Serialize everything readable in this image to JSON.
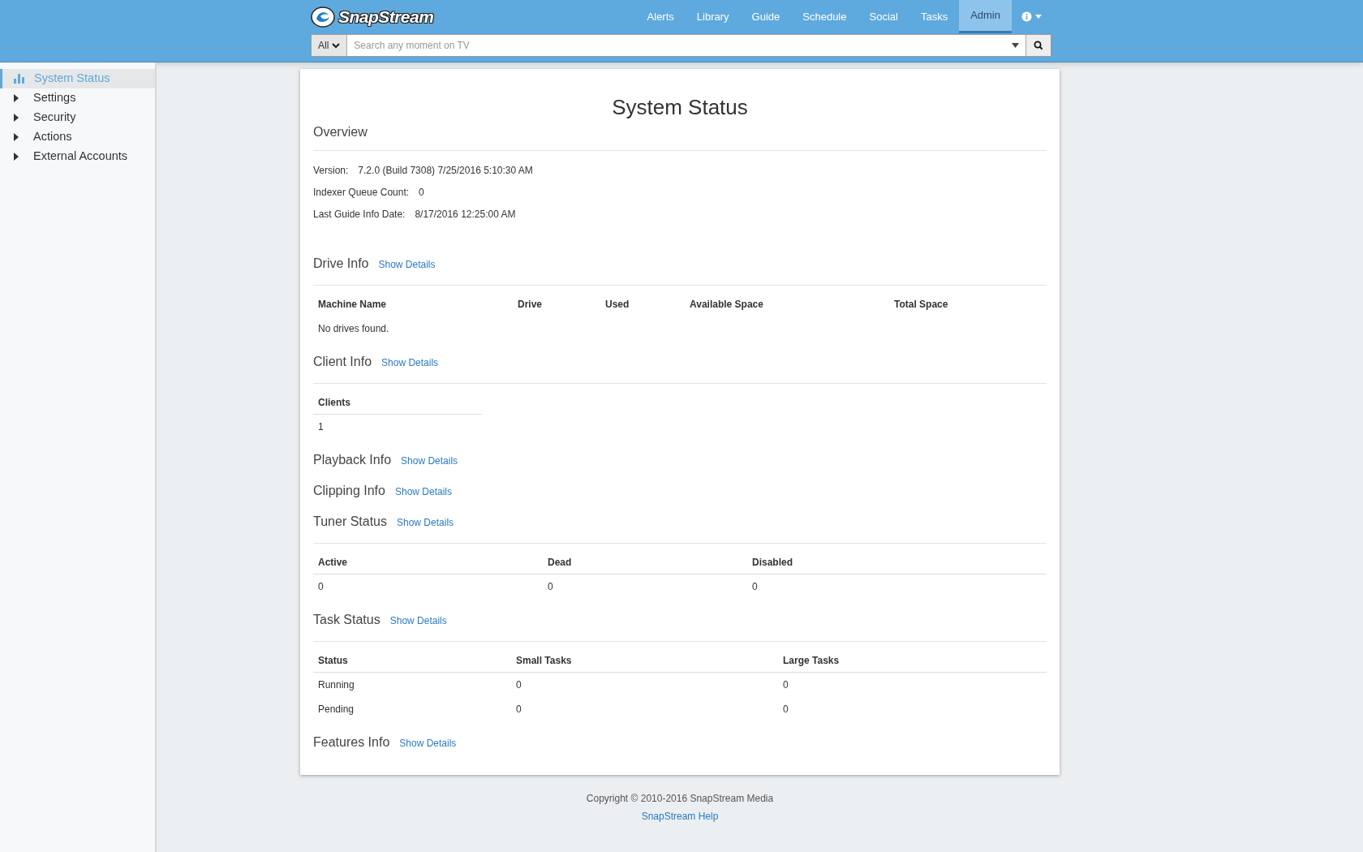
{
  "header": {
    "logo": "SnapStream",
    "nav": [
      {
        "label": "Alerts",
        "selected": false
      },
      {
        "label": "Library",
        "selected": false
      },
      {
        "label": "Guide",
        "selected": false
      },
      {
        "label": "Schedule",
        "selected": false
      },
      {
        "label": "Social",
        "selected": false
      },
      {
        "label": "Tasks",
        "selected": false
      },
      {
        "label": "Admin",
        "selected": true
      }
    ],
    "search": {
      "scope": "All",
      "placeholder": "Search any moment on TV"
    }
  },
  "sidebar": {
    "items": [
      {
        "label": "System Status",
        "kind": "page",
        "selected": true
      },
      {
        "label": "Settings",
        "kind": "group",
        "selected": false
      },
      {
        "label": "Security",
        "kind": "group",
        "selected": false
      },
      {
        "label": "Actions",
        "kind": "group",
        "selected": false
      },
      {
        "label": "External Accounts",
        "kind": "group",
        "selected": false
      }
    ]
  },
  "page_title": "System Status",
  "sections": [
    {
      "kind": "fields",
      "title": "Overview",
      "fields": [
        {
          "label": "Version:",
          "value": "7.2.0 (Build 7308) 7/25/2016 5:10:30 AM"
        },
        {
          "label": "Indexer Queue Count:",
          "value": "0"
        },
        {
          "label": "Last Guide Info Date:",
          "value": "8/17/2016 12:25:00 AM"
        }
      ]
    },
    {
      "kind": "table",
      "title": "Drive Info",
      "link": "Show Details",
      "columns": [
        "Machine Name",
        "Drive",
        "Used",
        "Available Space",
        "Total Space"
      ],
      "empty_message": "No drives found."
    },
    {
      "kind": "table",
      "title": "Client Info",
      "link": "Show Details",
      "columns": [
        "Clients"
      ],
      "rows": [
        [
          "1"
        ]
      ]
    },
    {
      "kind": "plain",
      "title": "Playback Info",
      "link": "Show Details"
    },
    {
      "kind": "plain",
      "title": "Clipping Info",
      "link": "Show Details"
    },
    {
      "kind": "table",
      "title": "Tuner Status",
      "link": "Show Details",
      "columns": [
        "Active",
        "Dead",
        "Disabled"
      ],
      "rows": [
        [
          "0",
          "0",
          "0"
        ]
      ]
    },
    {
      "kind": "table",
      "title": "Task Status",
      "link": "Show Details",
      "columns": [
        "Status",
        "Small Tasks",
        "Large Tasks"
      ],
      "rows": [
        [
          "Running",
          "0",
          "0"
        ],
        [
          "Pending",
          "0",
          "0"
        ]
      ]
    },
    {
      "kind": "plain",
      "title": "Features Info",
      "link": "Show Details"
    }
  ],
  "footer": {
    "copyright": "Copyright © 2010-2016 SnapStream Media",
    "link": "SnapStream Help"
  }
}
